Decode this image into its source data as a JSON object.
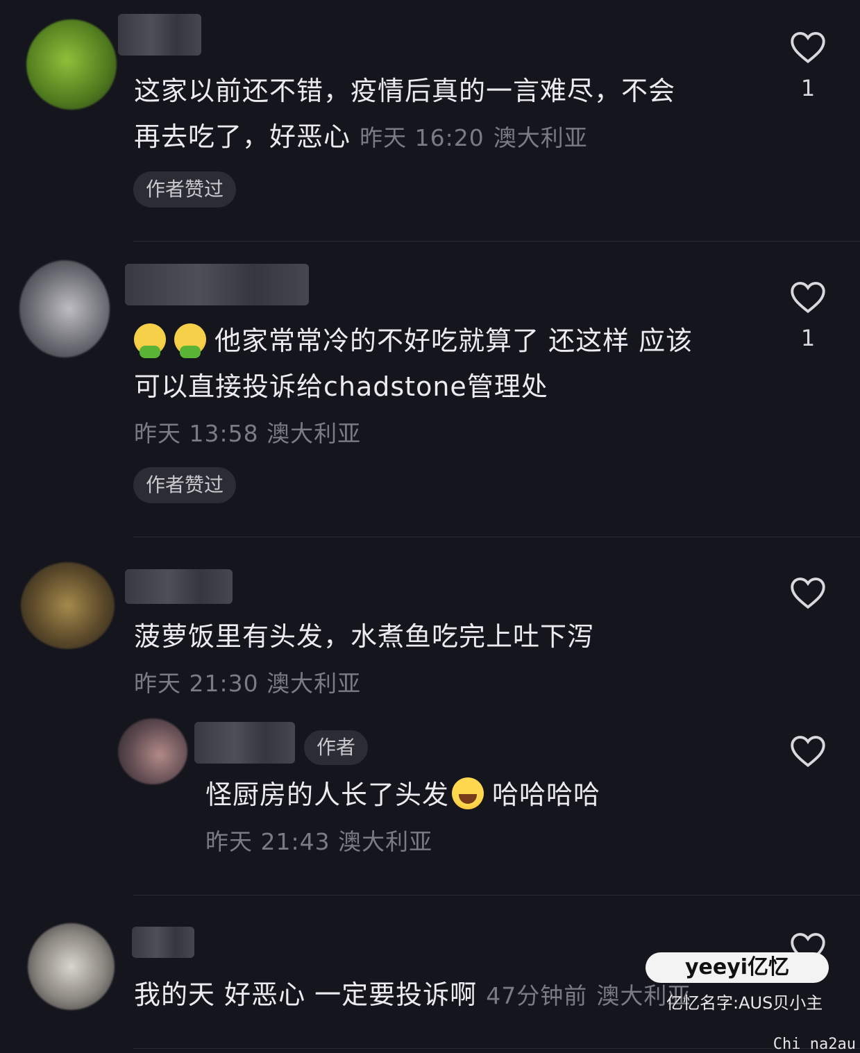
{
  "comments": [
    {
      "text": "这家以前还不错，疫情后真的一言难尽，不会再去吃了，好恶心",
      "line1": "这家以前还不错，疫情后真的一言难尽，不会",
      "line2": "再去吃了，好恶心",
      "time": "昨天 16:20",
      "location": "澳大利亚",
      "badge": "作者赞过",
      "likes": "1"
    },
    {
      "line1": "他家常常冷的不好吃就算了 还这样 应该",
      "line2": "可以直接投诉给chadstone管理处",
      "emoji": [
        "nauseated-face",
        "nauseated-face"
      ],
      "time": "昨天 13:58",
      "location": "澳大利亚",
      "badge": "作者赞过",
      "likes": "1"
    },
    {
      "line1": "菠萝饭里有头发，水煮鱼吃完上吐下泻",
      "time": "昨天 21:30",
      "location": "澳大利亚",
      "reply": {
        "author_tag": "作者",
        "text_before": "怪厨房的人长了头发",
        "emoji": "face-with-tears-of-joy",
        "text_after": "哈哈哈哈",
        "time": "昨天 21:43",
        "location": "澳大利亚"
      }
    },
    {
      "line1": "我的天 好恶心 一定要投诉啊",
      "time": "47分钟前",
      "location": "澳大利亚"
    }
  ],
  "watermark": {
    "brand": "yeeyi亿忆",
    "caption": "亿忆名字:AUS贝小主",
    "corner": "Chi na2au"
  }
}
